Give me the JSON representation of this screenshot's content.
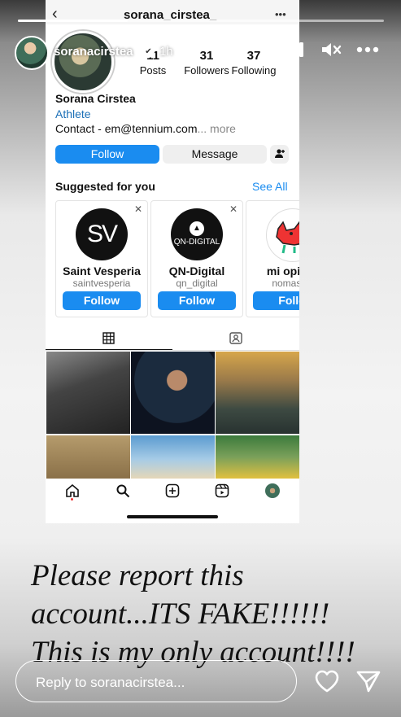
{
  "colors": {
    "accent": "#1a8cf0",
    "text": "#111111"
  },
  "story": {
    "progress": 0.3,
    "username": "soranacirstea",
    "time": "1h",
    "caption_lines": [
      "Please report this",
      "account...ITS FAKE!!!!!!",
      "This is my only account!!!!"
    ],
    "reply_placeholder": "Reply to soranacirstea..."
  },
  "screenshot": {
    "header_username": "sorana_cirstea_",
    "stats": [
      {
        "value": "11",
        "label": "Posts"
      },
      {
        "value": "31",
        "label": "Followers"
      },
      {
        "value": "37",
        "label": "Following"
      }
    ],
    "name": "Sorana Cirstea",
    "category": "Athlete",
    "contact": "Contact - em@tennium.com",
    "more": "... more",
    "follow_label": "Follow",
    "message_label": "Message",
    "suggested_title": "Suggested for you",
    "see_all": "See All",
    "suggestions": [
      {
        "name": "Saint Vesperia",
        "handle": "saintvesperia",
        "logo": "SV",
        "button": "Follow"
      },
      {
        "name": "QN-Digital",
        "handle": "qn_digital",
        "logo": "QN-DIGITAL",
        "button": "Follow"
      },
      {
        "name": "mi opinio",
        "handle": "nomasop",
        "logo": "",
        "button": "Follo"
      }
    ]
  }
}
